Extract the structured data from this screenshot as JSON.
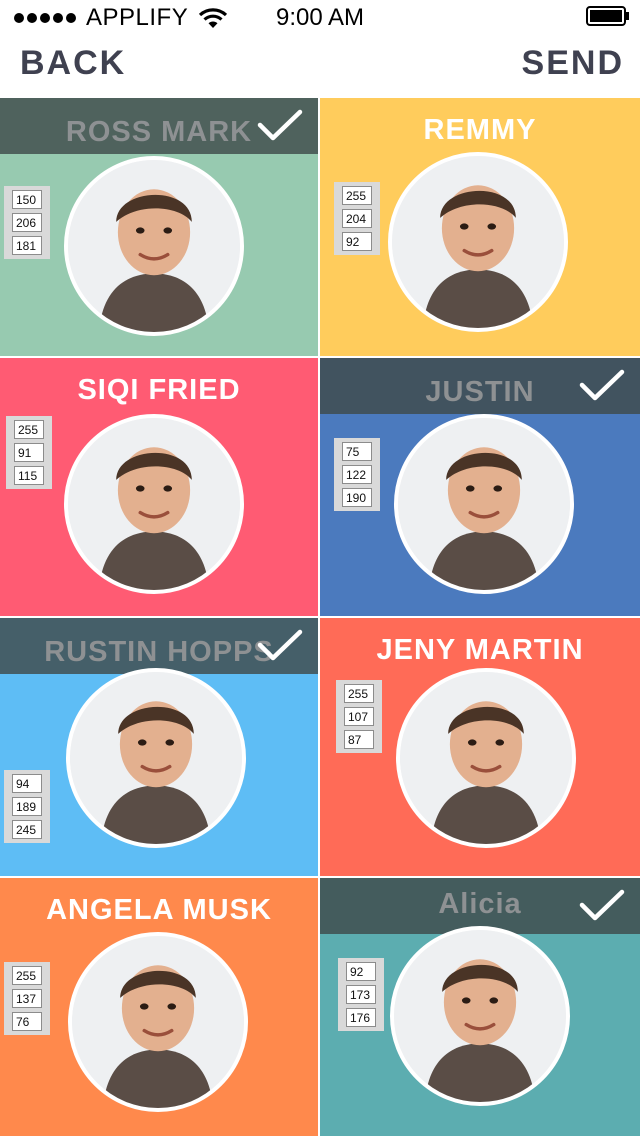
{
  "status_bar": {
    "carrier": "APPLIFY",
    "time": "9:00 AM"
  },
  "nav": {
    "back_label": "BACK",
    "send_label": "SEND"
  },
  "people": [
    {
      "name": "ROSS MARK",
      "selected": true,
      "bg": "#97CAB0",
      "rgb": [
        "150",
        "206",
        "181"
      ],
      "avatar": "person-photo"
    },
    {
      "name": "REMMY",
      "selected": false,
      "bg": "#FFCC5C",
      "rgb": [
        "255",
        "204",
        "92"
      ],
      "avatar": "person-photo"
    },
    {
      "name": "SIQI FRIED",
      "selected": false,
      "bg": "#FF5B73",
      "rgb": [
        "255",
        "91",
        "115"
      ],
      "avatar": "person-photo"
    },
    {
      "name": "JUSTIN",
      "selected": true,
      "bg": "#4B7ABE",
      "rgb": [
        "75",
        "122",
        "190"
      ],
      "avatar": "person-photo"
    },
    {
      "name": "RUSTIN HOPPS",
      "selected": true,
      "bg": "#5EBDF5",
      "rgb": [
        "94",
        "189",
        "245"
      ],
      "avatar": "person-photo"
    },
    {
      "name": "JENY MARTIN",
      "selected": false,
      "bg": "#FF6B57",
      "rgb": [
        "255",
        "107",
        "87"
      ],
      "avatar": "person-photo"
    },
    {
      "name": "ANGELA MUSK",
      "selected": false,
      "bg": "#FF894C",
      "rgb": [
        "255",
        "137",
        "76"
      ],
      "avatar": "person-photo"
    },
    {
      "name": "Alicia",
      "selected": true,
      "bg": "#5CADB0",
      "rgb": [
        "92",
        "173",
        "176"
      ],
      "avatar": "person-photo"
    }
  ],
  "colors": {
    "overlay": "#3F4A4A",
    "selected_name_text": "#8E9193",
    "name_text": "#FFFFFF",
    "check": "#FFFFFF"
  }
}
